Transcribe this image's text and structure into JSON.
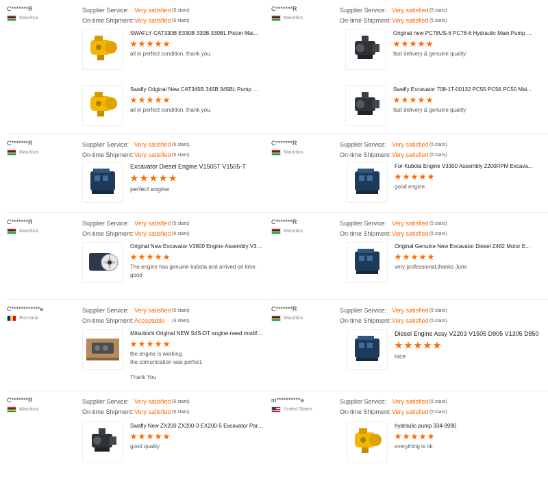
{
  "labels": {
    "supplier_service": "Supplier Service:",
    "ontime_shipment": "On-time Shipment:"
  },
  "colors": {
    "accent": "#ff6600",
    "star": "#ff6a00"
  },
  "reviews": [
    {
      "buyer": "C*******R",
      "country": "Mauritius",
      "flag": "flag-mu",
      "service": "Very satisfied",
      "service_stars": "(5 stars)",
      "shipment": "Very satisfied",
      "shipment_stars": "(5 stars)",
      "products": [
        {
          "title": "SWAFLY CAT330B E330B 330B 330BL Piston Main Pu...",
          "rating": 5,
          "comment": "all in perfect condition, thank you.",
          "icon": "yellow-pump-icon"
        },
        {
          "title": "Swafly Original New CAT345B 345B 345BL Pump Exc...",
          "rating": 5,
          "comment": "all in perfect condition, thank you.",
          "icon": "yellow-pump-icon"
        }
      ]
    },
    {
      "buyer": "C*******R",
      "country": "Mauritius",
      "flag": "flag-mu",
      "service": "Very satisfied",
      "service_stars": "(5 stars)",
      "shipment": "Very satisfied",
      "shipment_stars": "(5 stars)",
      "products": [
        {
          "title": "Original new PC78US-6 PC78-6 Hydraulic Main Pump ...",
          "rating": 5,
          "comment": "fast delivery & genuine quality",
          "icon": "dark-pump-icon"
        },
        {
          "title": "Swafly Excavator 708-1T-00132 PC55 PC56 PC50 Mai...",
          "rating": 5,
          "comment": "fast delivery & genuine quality",
          "icon": "dark-pump-icon"
        }
      ]
    },
    {
      "buyer": "C*******R",
      "country": "Mauritius",
      "flag": "flag-mu",
      "service": "Very satisfied",
      "service_stars": "(5 stars)",
      "shipment": "Very satisfied",
      "shipment_stars": "(5 stars)",
      "products": [
        {
          "title": "Excavator Diesel Engine V1505T V1505-T",
          "rating": 5,
          "comment": "perfect engine",
          "icon": "engine-icon"
        }
      ]
    },
    {
      "buyer": "C*******R",
      "country": "Mauritius",
      "flag": "flag-mu",
      "service": "Very satisfied",
      "service_stars": "(5 stars)",
      "shipment": "Very satisfied",
      "shipment_stars": "(5 stars)",
      "products": [
        {
          "title": "For Kubota Engine V3300 Assembly 2200RPM Excava...",
          "rating": 5,
          "comment": "good engine",
          "icon": "engine-icon"
        }
      ]
    },
    {
      "buyer": "C*******R",
      "country": "Mauritius",
      "flag": "flag-mu",
      "service": "Very satisfied",
      "service_stars": "(5 stars)",
      "shipment": "Very satisfied",
      "shipment_stars": "(5 stars)",
      "products": [
        {
          "title": "Original New Excavator V3800 Engine Assembly V380...",
          "rating": 5,
          "comment": "The engine has genuine kubota and arrived on time. good",
          "icon": "engine-fan-icon"
        }
      ]
    },
    {
      "buyer": "C*******R",
      "country": "Mauritius",
      "flag": "flag-mu",
      "service": "Very satisfied",
      "service_stars": "(5 stars)",
      "shipment": "Very satisfied",
      "shipment_stars": "(5 stars)",
      "products": [
        {
          "title": "Original Genuine New Excavator Diesel Z482 Motor E...",
          "rating": 5,
          "comment": "very professional,thanks June",
          "icon": "engine-icon"
        }
      ]
    },
    {
      "buyer": "C************e",
      "country": "Romania",
      "flag": "flag-ro",
      "service": "Very satisfied",
      "service_stars": "(5 stars)",
      "shipment": "Acceptable",
      "shipment_stars": "(3 stars)",
      "products": [
        {
          "title": "Mitsubishi Original NEW S4S-DT engine-need modific...",
          "rating": 5,
          "comment": "the engine is working.",
          "comment2": "the comunication was perfect.",
          "comment3": "Thank You",
          "icon": "engine-crate-icon"
        }
      ]
    },
    {
      "buyer": "C*******R",
      "country": "Mauritius",
      "flag": "flag-mu",
      "service": "Very satisfied",
      "service_stars": "(5 stars)",
      "shipment": "Very satisfied",
      "shipment_stars": "(5 stars)",
      "products": [
        {
          "title": "Diesel Engine Assy V2203 V1505 D905 V1305 D850",
          "rating": 5,
          "comment": "nice",
          "icon": "engine-icon"
        }
      ]
    },
    {
      "buyer": "C*******R",
      "country": "Mauritius",
      "flag": "flag-mu",
      "service": "Very satisfied",
      "service_stars": "(5 stars)",
      "shipment": "Very satisfied",
      "shipment_stars": "(5 stars)",
      "products": [
        {
          "title": "Swafly New ZX200 ZX200-3 EX200-5 Excavator Parts ...",
          "rating": 5,
          "comment": "good quality",
          "icon": "dark-pump-icon"
        }
      ]
    },
    {
      "buyer": "m**********a",
      "country": "United States",
      "flag": "flag-us",
      "service": "Very satisfied",
      "service_stars": "(5 stars)",
      "shipment": "Very satisfied",
      "shipment_stars": "(5 stars)",
      "products": [
        {
          "title": "hydraulic pump 334-9990",
          "rating": 5,
          "comment": "everything is ok",
          "icon": "yellow-pump-icon"
        }
      ]
    }
  ]
}
